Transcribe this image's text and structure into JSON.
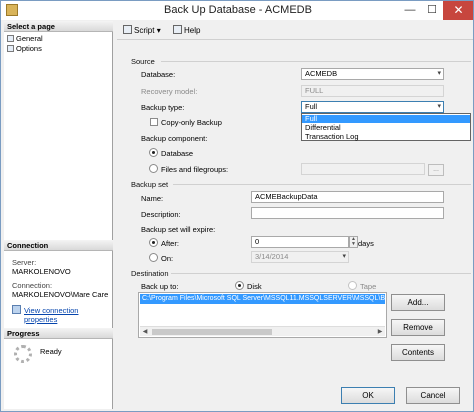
{
  "window": {
    "title": "Back Up Database - ACMEDB",
    "minimize": "—",
    "maximize": "☐",
    "close": "✕"
  },
  "left_pane": {
    "select_page_header": "Select a page",
    "pages": [
      "General",
      "Options"
    ],
    "connection_header": "Connection",
    "server_label": "Server:",
    "server_value": "MARKOLENOVO",
    "connection_label": "Connection:",
    "connection_value": "MARKOLENOVO\\Mare Care",
    "view_connection_link": "View connection properties",
    "progress_header": "Progress",
    "progress_status": "Ready"
  },
  "toolbar": {
    "script_label": "Script",
    "script_arrow": "▾",
    "help_label": "Help"
  },
  "source": {
    "group_label": "Source",
    "database_label": "Database:",
    "database_value": "ACMEDB",
    "recovery_model_label": "Recovery model:",
    "recovery_model_value": "FULL",
    "backup_type_label": "Backup type:",
    "backup_type_value": "Full",
    "backup_type_options": [
      "Full",
      "Differential",
      "Transaction Log"
    ],
    "copy_only_label": "Copy-only Backup",
    "backup_component_label": "Backup component:",
    "component_database": "Database",
    "component_files": "Files and filegroups:",
    "browse_label": "..."
  },
  "backup_set": {
    "group_label": "Backup set",
    "name_label": "Name:",
    "name_value": "ACMEBackupData",
    "description_label": "Description:",
    "description_value": "",
    "expire_label": "Backup set will expire:",
    "after_label": "After:",
    "after_value": "0",
    "days_label": "days",
    "on_label": "On:",
    "on_value": "3/14/2014"
  },
  "destination": {
    "group_label": "Destination",
    "back_up_to_label": "Back up to:",
    "disk_label": "Disk",
    "tape_label": "Tape",
    "path": "C:\\Program Files\\Microsoft SQL Server\\MSSQL11.MSSQLSERVER\\MSSQL\\Backup\\ACMEDB.bak",
    "add_label": "Add...",
    "remove_label": "Remove",
    "contents_label": "Contents"
  },
  "buttons": {
    "ok": "OK",
    "cancel": "Cancel"
  },
  "colors": {
    "accent": "#3399ff",
    "close": "#c7463e",
    "link": "#0645ad"
  },
  "icons": [
    "app-icon",
    "script-icon",
    "help-icon",
    "page-icon",
    "link-icon",
    "spinner-icon",
    "dropdown-arrow-icon",
    "calendar-icon"
  ]
}
